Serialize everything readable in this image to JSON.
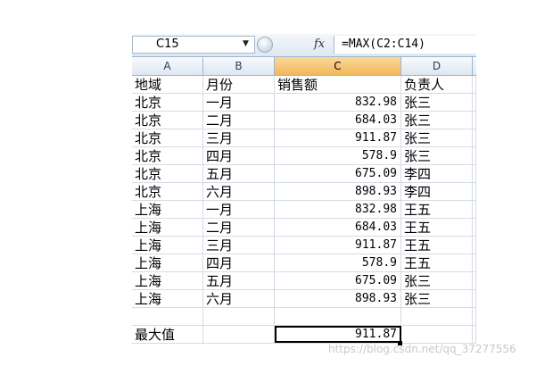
{
  "formula_bar": {
    "name_box": "C15",
    "fx_label": "fx",
    "formula": "=MAX(C2:C14)"
  },
  "columns": [
    "A",
    "B",
    "C",
    "D"
  ],
  "selected_column": "C",
  "header_row": [
    "地域",
    "月份",
    "销售额",
    "负责人"
  ],
  "rows": [
    [
      "北京",
      "一月",
      "832.98",
      "张三"
    ],
    [
      "北京",
      "二月",
      "684.03",
      "张三"
    ],
    [
      "北京",
      "三月",
      "911.87",
      "张三"
    ],
    [
      "北京",
      "四月",
      "578.9",
      "张三"
    ],
    [
      "北京",
      "五月",
      "675.09",
      "李四"
    ],
    [
      "北京",
      "六月",
      "898.93",
      "李四"
    ],
    [
      "上海",
      "一月",
      "832.98",
      "王五"
    ],
    [
      "上海",
      "二月",
      "684.03",
      "王五"
    ],
    [
      "上海",
      "三月",
      "911.87",
      "王五"
    ],
    [
      "上海",
      "四月",
      "578.9",
      "王五"
    ],
    [
      "上海",
      "五月",
      "675.09",
      "张三"
    ],
    [
      "上海",
      "六月",
      "898.93",
      "张三"
    ]
  ],
  "result_row": [
    "最大值",
    "",
    "911.87",
    ""
  ],
  "watermark": "https://blog.csdn.net/qq_37277556"
}
